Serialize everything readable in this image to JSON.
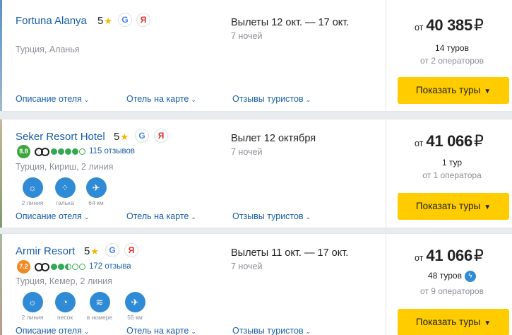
{
  "hotels": [
    {
      "name": "Fortuna Alanya",
      "stars": "5",
      "google_badge": "G",
      "yandex_badge": "Я",
      "location": "Турция, Аланья",
      "dates": "Вылеты 12 окт. — 17 окт.",
      "nights": "7 ночей",
      "links": {
        "description": "Описание отеля",
        "map": "Отель на карте",
        "reviews": "Отзывы туристов"
      },
      "price": {
        "from": "от",
        "value": "40 385",
        "currency": "₽"
      },
      "tours": "14 туров",
      "operators": "от 2 операторов",
      "button": "Показать туры"
    },
    {
      "name": "Seker Resort Hotel",
      "stars": "5",
      "google_badge": "G",
      "yandex_badge": "Я",
      "rating": "8.8",
      "rating_color": "#3ca53c",
      "ta_score": 4,
      "ta_half": false,
      "reviews": "115 отзывов",
      "location": "Турция, Кириш, 2 линия",
      "amenities": [
        {
          "icon": "beach-icon",
          "glyph": "☼",
          "label": "2 линия"
        },
        {
          "icon": "pebble-icon",
          "glyph": "⁘",
          "label": "галька"
        },
        {
          "icon": "airport-icon",
          "glyph": "✈",
          "label": "64 км"
        }
      ],
      "dates": "Вылет 12 октября",
      "nights": "7 ночей",
      "links": {
        "description": "Описание отеля",
        "map": "Отель на карте",
        "reviews": "Отзывы туристов"
      },
      "price": {
        "from": "от",
        "value": "41 066",
        "currency": "₽"
      },
      "tours": "1 тур",
      "operators": "от 1 оператора",
      "button": "Показать туры"
    },
    {
      "name": "Armir Resort",
      "stars": "5",
      "google_badge": "G",
      "yandex_badge": "Я",
      "rating": "7.2",
      "rating_color": "#f08a24",
      "ta_score": 2,
      "ta_half": true,
      "reviews": "172 отзыва",
      "location": "Турция, Кемер, 2 линия",
      "amenities": [
        {
          "icon": "beach-icon",
          "glyph": "☼",
          "label": "2 линия"
        },
        {
          "icon": "sand-icon",
          "glyph": "◔",
          "label": "песок"
        },
        {
          "icon": "wifi-icon",
          "glyph": "≋",
          "label": "в номере"
        },
        {
          "icon": "airport-icon",
          "glyph": "✈",
          "label": "55 км"
        }
      ],
      "dates": "Вылеты 11 окт. — 17 окт.",
      "nights": "7 ночей",
      "links": {
        "description": "Описание отеля",
        "map": "Отель на карте",
        "reviews": "Отзывы туристов"
      },
      "price": {
        "from": "от",
        "value": "41 066",
        "currency": "₽"
      },
      "tours": "48 туров",
      "tours_badge": "lightning-icon",
      "operators": "от 9 операторов",
      "button": "Показать туры"
    }
  ],
  "colors": {
    "accent": "#ffcc00",
    "link": "#1a5fa8",
    "icon_blue": "#2f8bd6"
  }
}
